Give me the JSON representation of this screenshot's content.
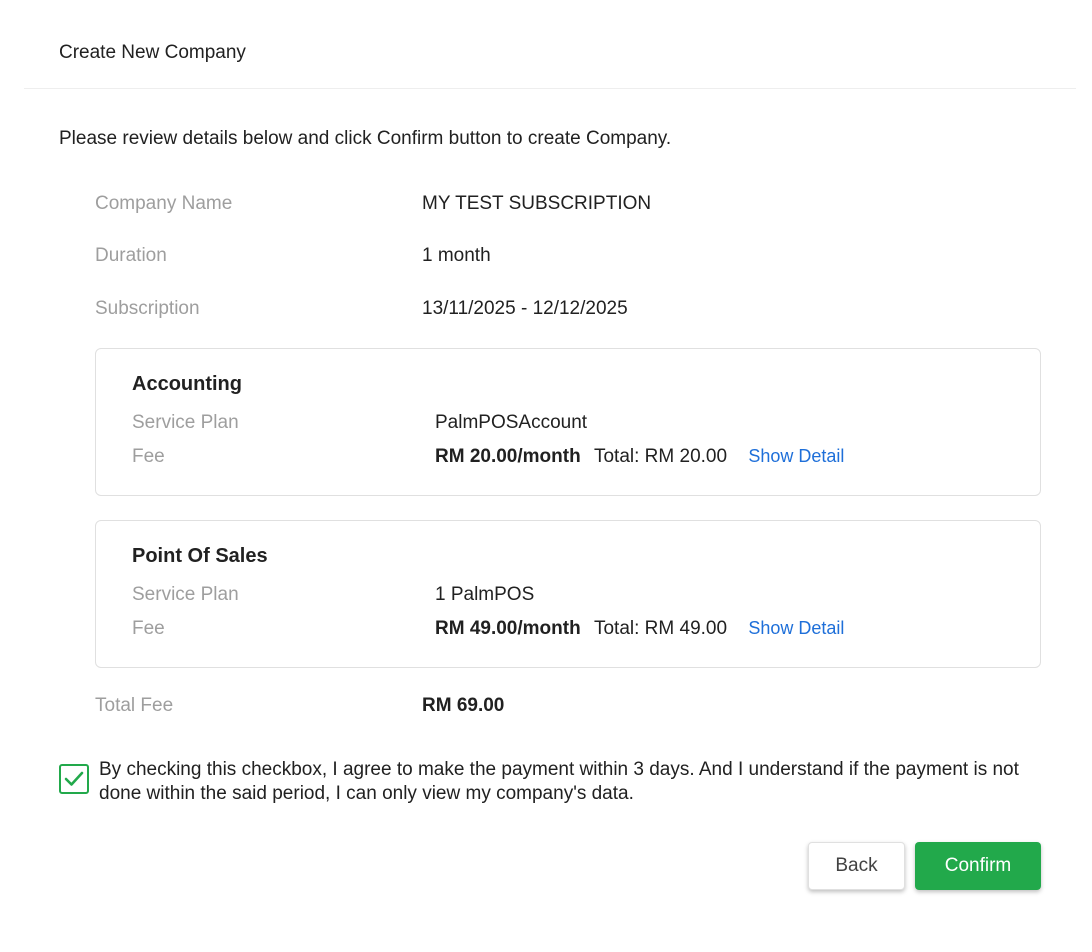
{
  "header": {
    "title": "Create New Company"
  },
  "intro": "Please review details below and click Confirm button to create Company.",
  "summary": {
    "company_name_label": "Company Name",
    "company_name_value": "MY TEST SUBSCRIPTION",
    "duration_label": "Duration",
    "duration_value": "1 month",
    "subscription_label": "Subscription",
    "subscription_value": "13/11/2025 - 12/12/2025"
  },
  "modules": [
    {
      "title": "Accounting",
      "service_plan_label": "Service Plan",
      "service_plan_value": "PalmPOSAccount",
      "fee_label": "Fee",
      "fee_rate": "RM 20.00/month",
      "fee_total": "Total: RM 20.00",
      "show_detail": "Show Detail"
    },
    {
      "title": "Point Of Sales",
      "service_plan_label": "Service Plan",
      "service_plan_value": "1 PalmPOS",
      "fee_label": "Fee",
      "fee_rate": "RM 49.00/month",
      "fee_total": "Total: RM 49.00",
      "show_detail": "Show Detail"
    }
  ],
  "total": {
    "label": "Total Fee",
    "value": "RM 69.00"
  },
  "agreement": {
    "checked": true,
    "text": "By checking this checkbox, I agree to make the payment within 3 days. And I understand if the payment is not done within the said period, I can only view my company's data."
  },
  "buttons": {
    "back": "Back",
    "confirm": "Confirm"
  },
  "colors": {
    "primary_green": "#22a94b",
    "link_blue": "#1e6fd9",
    "label_gray": "#9e9e9e"
  }
}
